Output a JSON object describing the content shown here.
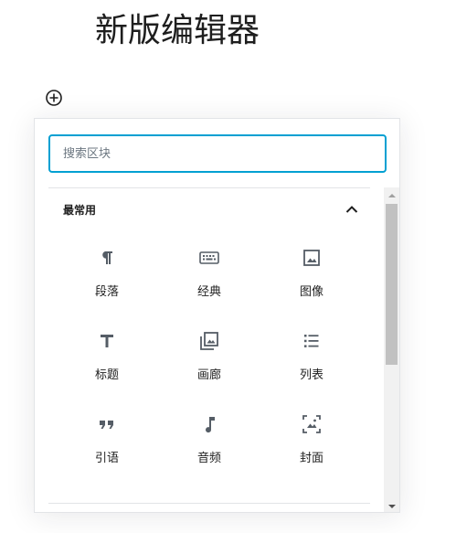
{
  "page": {
    "title": "新版编辑器"
  },
  "inserter": {
    "search": {
      "placeholder": "搜索区块",
      "value": ""
    },
    "panel": {
      "title": "最常用",
      "expanded": true
    },
    "blocks": [
      {
        "label": "段落",
        "icon": "paragraph-icon"
      },
      {
        "label": "经典",
        "icon": "keyboard-icon"
      },
      {
        "label": "图像",
        "icon": "image-icon"
      },
      {
        "label": "标题",
        "icon": "heading-icon"
      },
      {
        "label": "画廊",
        "icon": "gallery-icon"
      },
      {
        "label": "列表",
        "icon": "list-icon"
      },
      {
        "label": "引语",
        "icon": "quote-icon"
      },
      {
        "label": "音频",
        "icon": "audio-icon"
      },
      {
        "label": "封面",
        "icon": "cover-icon"
      }
    ]
  },
  "colors": {
    "accent": "#00a0d2",
    "text": "#1e1e1e",
    "icon": "#555d66",
    "border": "#e2e4e7"
  }
}
